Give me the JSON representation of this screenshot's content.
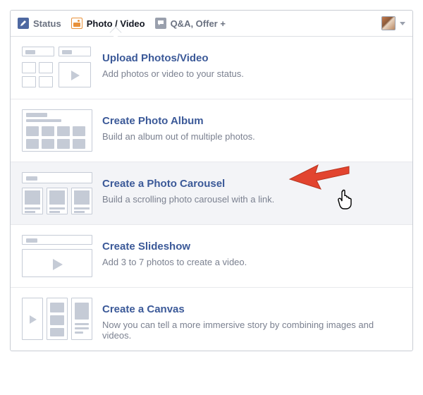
{
  "tabs": {
    "status": "Status",
    "photo": "Photo / Video",
    "qa": "Q&A, Offer +"
  },
  "options": [
    {
      "title": "Upload Photos/Video",
      "desc": "Add photos or video to your status."
    },
    {
      "title": "Create Photo Album",
      "desc": "Build an album out of multiple photos."
    },
    {
      "title": "Create a Photo Carousel",
      "desc": "Build a scrolling photo carousel with a link."
    },
    {
      "title": "Create Slideshow",
      "desc": "Add 3 to 7 photos to create a video."
    },
    {
      "title": "Create a Canvas",
      "desc": "Now you can tell a more immersive story by combining images and videos."
    }
  ]
}
